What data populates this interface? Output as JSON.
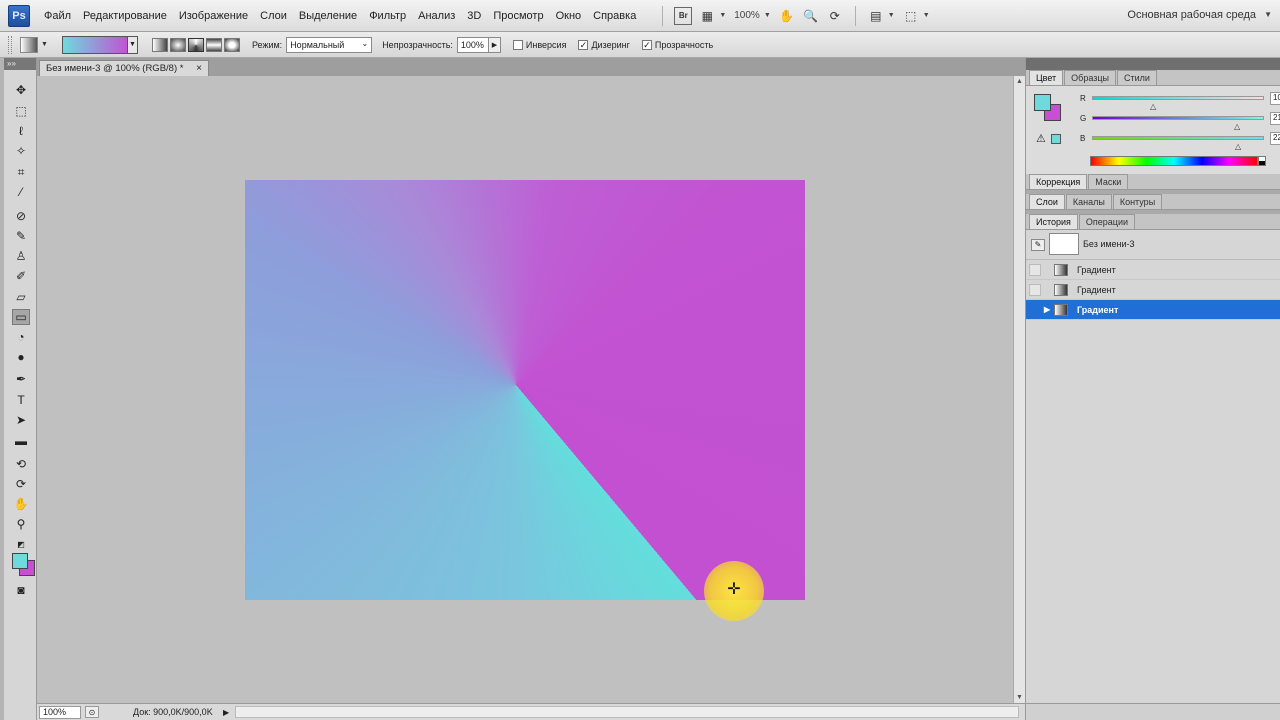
{
  "app": {
    "logo": "Ps"
  },
  "menu": [
    "Файл",
    "Редактирование",
    "Изображение",
    "Слои",
    "Выделение",
    "Фильтр",
    "Анализ",
    "3D",
    "Просмотр",
    "Окно",
    "Справка"
  ],
  "menubar_tools": {
    "bridge_label": "Br",
    "zoom": "100%"
  },
  "workspace": {
    "label": "Основная рабочая среда"
  },
  "options": {
    "gradient_colors": [
      "#6fd9dc",
      "#c054d2"
    ],
    "mode_label": "Режим:",
    "mode_value": "Нормальный",
    "opacity_label": "Непрозрачность:",
    "opacity_value": "100%",
    "inverse_label": "Инверсия",
    "dither_label": "Дизеринг",
    "transparency_label": "Прозрачность",
    "inverse_checked": false,
    "dither_checked": true,
    "transparency_checked": true
  },
  "toolbar": {
    "header": "»»",
    "active_tool": "gradient-tool"
  },
  "document": {
    "tab_title": "Без имени-3 @ 100% (RGB/8) *",
    "close": "×"
  },
  "colors": {
    "foreground": "#6fdadd",
    "background": "#c84fd3"
  },
  "statusbar": {
    "zoom": "100%",
    "doc_info": "Док: 900,0K/900,0K",
    "arrow": "▶"
  },
  "panel_color": {
    "tabs": [
      "Цвет",
      "Образцы",
      "Стили"
    ],
    "active_tab": "Цвет",
    "sliders": [
      {
        "label": "R",
        "value": "10"
      },
      {
        "label": "G",
        "value": "21"
      },
      {
        "label": "B",
        "value": "22"
      }
    ]
  },
  "panel_adjust": {
    "tabs": [
      "Коррекция",
      "Маски"
    ]
  },
  "panel_layers": {
    "tabs": [
      "Слои",
      "Каналы",
      "Контуры"
    ]
  },
  "panel_history": {
    "tabs": [
      "История",
      "Операции"
    ],
    "snapshot_label": "Без имени-3",
    "items": [
      {
        "label": "Градиент",
        "active": false
      },
      {
        "label": "Градиент",
        "active": false
      },
      {
        "label": "Градиент",
        "active": true
      }
    ]
  }
}
